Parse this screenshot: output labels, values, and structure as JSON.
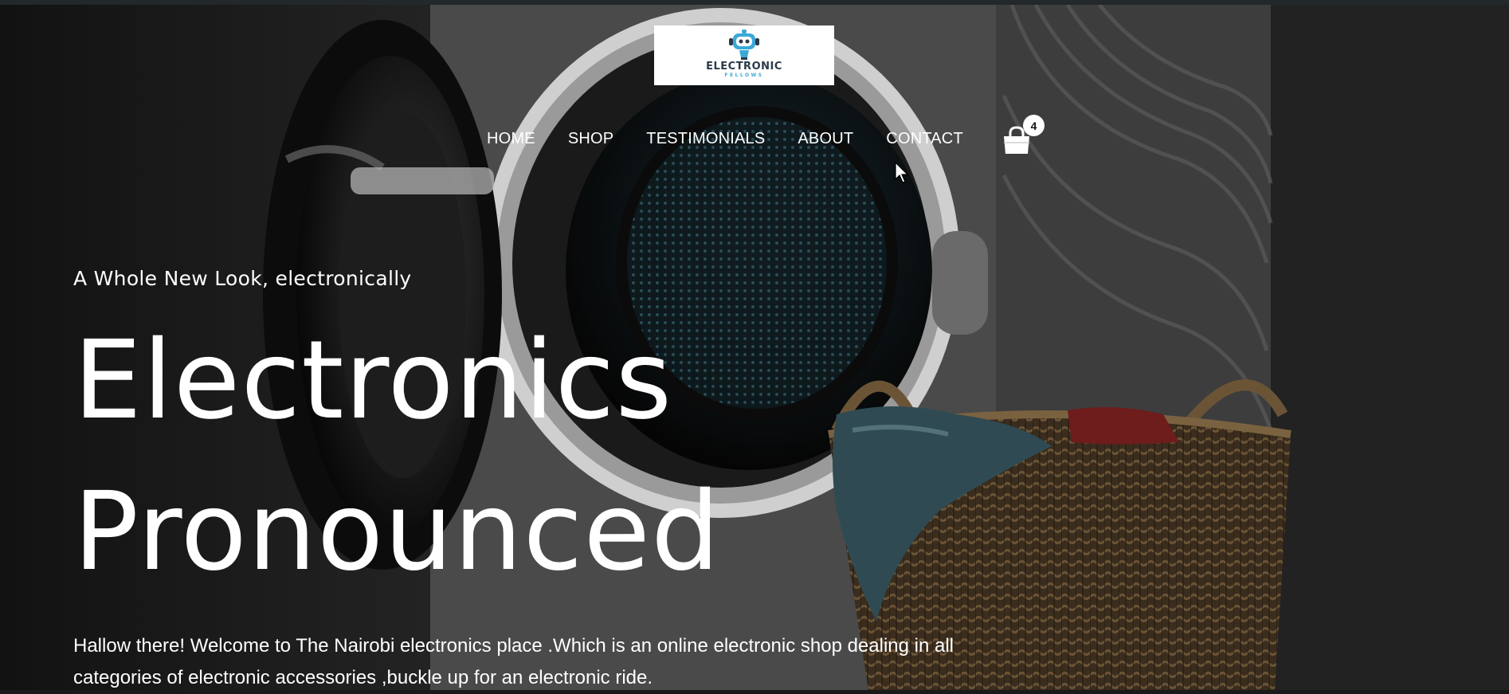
{
  "brand": {
    "name": "ELECTRONIC",
    "sub": "FELLOWS",
    "accent": "#3aa9d8"
  },
  "nav": {
    "items": [
      {
        "label": "HOME"
      },
      {
        "label": "SHOP"
      },
      {
        "label": "TESTIMONIALS"
      },
      {
        "label": "ABOUT"
      },
      {
        "label": "CONTACT"
      }
    ]
  },
  "cart": {
    "icon": "shopping-bag-icon",
    "count": "4"
  },
  "hero": {
    "tagline": "A Whole New Look, electronically",
    "headline_line1": "Electronics",
    "headline_line2": "Pronounced",
    "intro": "Hallow there! Welcome to The Nairobi electronics place .Which is an online electronic shop dealing in all categories of electronic accessories ,buckle up for an electronic ride."
  },
  "colors": {
    "text": "#ffffff",
    "background": "#1a1a1a"
  }
}
